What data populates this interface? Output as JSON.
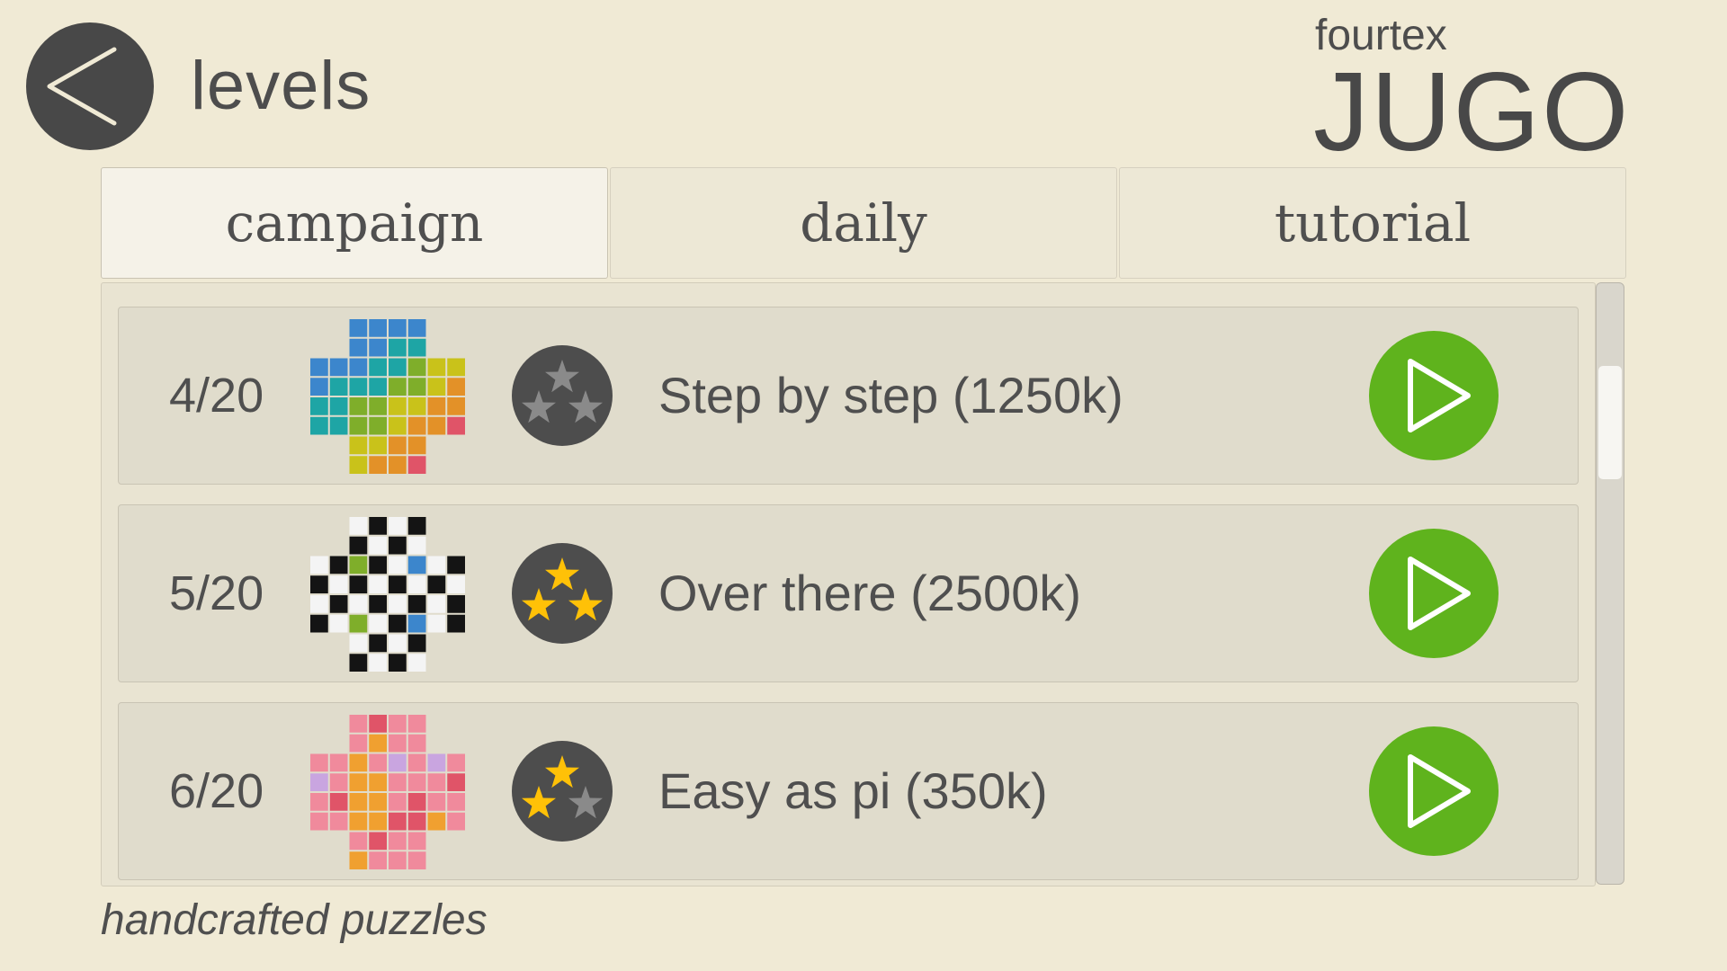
{
  "header": {
    "back_icon": "chevron-left-icon",
    "title": "levels",
    "logo_sub": "fourtex",
    "logo_main": "JUGO"
  },
  "tabs": [
    {
      "label": "campaign",
      "active": true
    },
    {
      "label": "daily",
      "active": false
    },
    {
      "label": "tutorial",
      "active": false
    }
  ],
  "levels": [
    {
      "number": "4/20",
      "name": "Step by step (1250k)",
      "stars_earned": 0,
      "stars_total": 3,
      "play_icon": "play-icon",
      "thumbnail": [
        "..BBBB..",
        "..BBTT..",
        "BBBTTGYY",
        "BTTTGGYO",
        "TTGGYYOO",
        "TTGGYOOR",
        "..YYOO..",
        "..YOOR.."
      ]
    },
    {
      "number": "5/20",
      "name": "Over there (2500k)",
      "stars_earned": 3,
      "stars_total": 3,
      "play_icon": "play-icon",
      "thumbnail": [
        "..WKWK..",
        "..KWKW..",
        "WKGKWBWK",
        "KWKWKWKW",
        "WKWKWKWK",
        "KWGWKBWK",
        "..WKWK..",
        "..KWKW.."
      ]
    },
    {
      "number": "6/20",
      "name": "Easy as pi (350k)",
      "stars_earned": 2,
      "stars_total": 3,
      "play_icon": "play-icon",
      "thumbnail": [
        "..PRPP..",
        "..PAPP..",
        "PPAPLPLP",
        "LPAAPPPR",
        "PRAAPRPP",
        "PPAARRAP",
        "..PRPP..",
        "..APPP.."
      ]
    }
  ],
  "footer": {
    "tagline": "handcrafted puzzles"
  },
  "colors": {
    "background": "#f0ead5",
    "play_green": "#5fb31d",
    "star_gold": "#ffc107",
    "star_gray": "#8a8a8a",
    "dark_circle": "#4d4d4d"
  },
  "thumbnail_palette": {
    "B": "#3c86cc",
    "T": "#1ea5a5",
    "G": "#7fae2a",
    "Y": "#c9c21a",
    "O": "#e39128",
    "R": "#e05468",
    "W": "#f4f4f4",
    "K": "#141414",
    "P": "#f08a9c",
    "A": "#f0a030",
    "L": "#c9a5e0",
    "Gr": "#7cc93a",
    "Bl": "#4a90d9"
  }
}
